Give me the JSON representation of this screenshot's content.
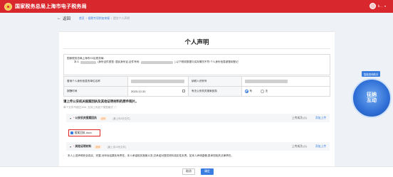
{
  "header": {
    "site_title": "国家税务总局上海市电子税务局",
    "user_name": "k..."
  },
  "nav": {
    "back_label": "返回",
    "breadcrumbs": [
      "首页",
      "個税专项附加申报",
      "提交个人声明"
    ]
  },
  "card": {
    "title": "个人声明",
    "address_to": "国家税务总局上海市XX区税务局:",
    "address_prefix": "本人",
    "address_mid": "(身份证件类型: 居民身份证,证件号码:",
    "address_suffix": "),以下税收数据与实际情况不符:个人身份信息被冒用登记"
  },
  "form": {
    "row1_label_left": "冒用个人身份信息的单位名称",
    "row1_label_right": "纳税人识别号",
    "row2_label_left": "报酬时间",
    "row2_date": "2023-12-31",
    "row2_label_right": "有无公安机关报案回执",
    "radio_yes": "有",
    "radio_no": "无",
    "radio_selected": "有"
  },
  "upload": {
    "heading": "请上传公安机关报案回执及其他证明材料的原件照片。",
    "note": "单个文件不超过10M, 支持上传如下类型格式 ⓘ",
    "sections": [
      {
        "name": "公安机关报案回执",
        "tag": "必传",
        "hint": "(最上传1份文件)",
        "status": "上传成功 (1)",
        "upload_label": "添加上传"
      },
      {
        "name": "其他证明材料",
        "tag": "选传",
        "hint": "(最上传10份文件)",
        "status": "上传成功 (1)",
        "upload_label": "添加上传"
      }
    ],
    "file_name": "报案回执.docx"
  },
  "statement": "本人上述声明完全真实、完整,对申诉结果负有责任。本人承诺相关报案义务,并承诺对提供资料真实性负责。如本人声明虚假,愿承担相关法律责任。",
  "buttons": {
    "cancel": "取消",
    "confirm": "确定"
  },
  "side": {
    "badge": "智能咨询助手",
    "assistant_label": "征纳\n互动"
  },
  "colors": {
    "brand_red": "#d9272e",
    "accent_blue": "#3a7de0",
    "highlight_box": "#e02020"
  }
}
